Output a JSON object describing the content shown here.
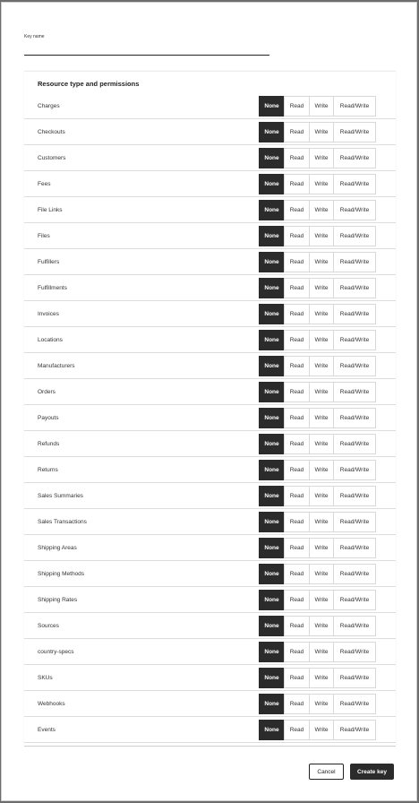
{
  "form": {
    "key_name_label": "Key name",
    "key_name_value": "",
    "section_title": "Resource type and permissions",
    "options": [
      "None",
      "Read",
      "Write",
      "Read/Write"
    ],
    "resources": [
      {
        "label": "Charges",
        "selected": "None"
      },
      {
        "label": "Checkouts",
        "selected": "None"
      },
      {
        "label": "Customers",
        "selected": "None"
      },
      {
        "label": "Fees",
        "selected": "None"
      },
      {
        "label": "File Links",
        "selected": "None"
      },
      {
        "label": "Files",
        "selected": "None"
      },
      {
        "label": "Fulfillers",
        "selected": "None"
      },
      {
        "label": "Fulfillments",
        "selected": "None"
      },
      {
        "label": "Invoices",
        "selected": "None"
      },
      {
        "label": "Locations",
        "selected": "None"
      },
      {
        "label": "Manufacturers",
        "selected": "None"
      },
      {
        "label": "Orders",
        "selected": "None"
      },
      {
        "label": "Payouts",
        "selected": "None"
      },
      {
        "label": "Refunds",
        "selected": "None"
      },
      {
        "label": "Returns",
        "selected": "None"
      },
      {
        "label": "Sales Summaries",
        "selected": "None"
      },
      {
        "label": "Sales Transactions",
        "selected": "None"
      },
      {
        "label": "Shipping Areas",
        "selected": "None"
      },
      {
        "label": "Shipping Methods",
        "selected": "None"
      },
      {
        "label": "Shipping Rates",
        "selected": "None"
      },
      {
        "label": "Sources",
        "selected": "None"
      },
      {
        "label": "country-specs",
        "selected": "None"
      },
      {
        "label": "SKUs",
        "selected": "None"
      },
      {
        "label": "Webhooks",
        "selected": "None"
      },
      {
        "label": "Events",
        "selected": "None"
      }
    ]
  },
  "footer": {
    "cancel_label": "Cancel",
    "create_label": "Create key"
  },
  "colors": {
    "overlay": "#6d6d6d",
    "selected": "#2b2b2b"
  }
}
